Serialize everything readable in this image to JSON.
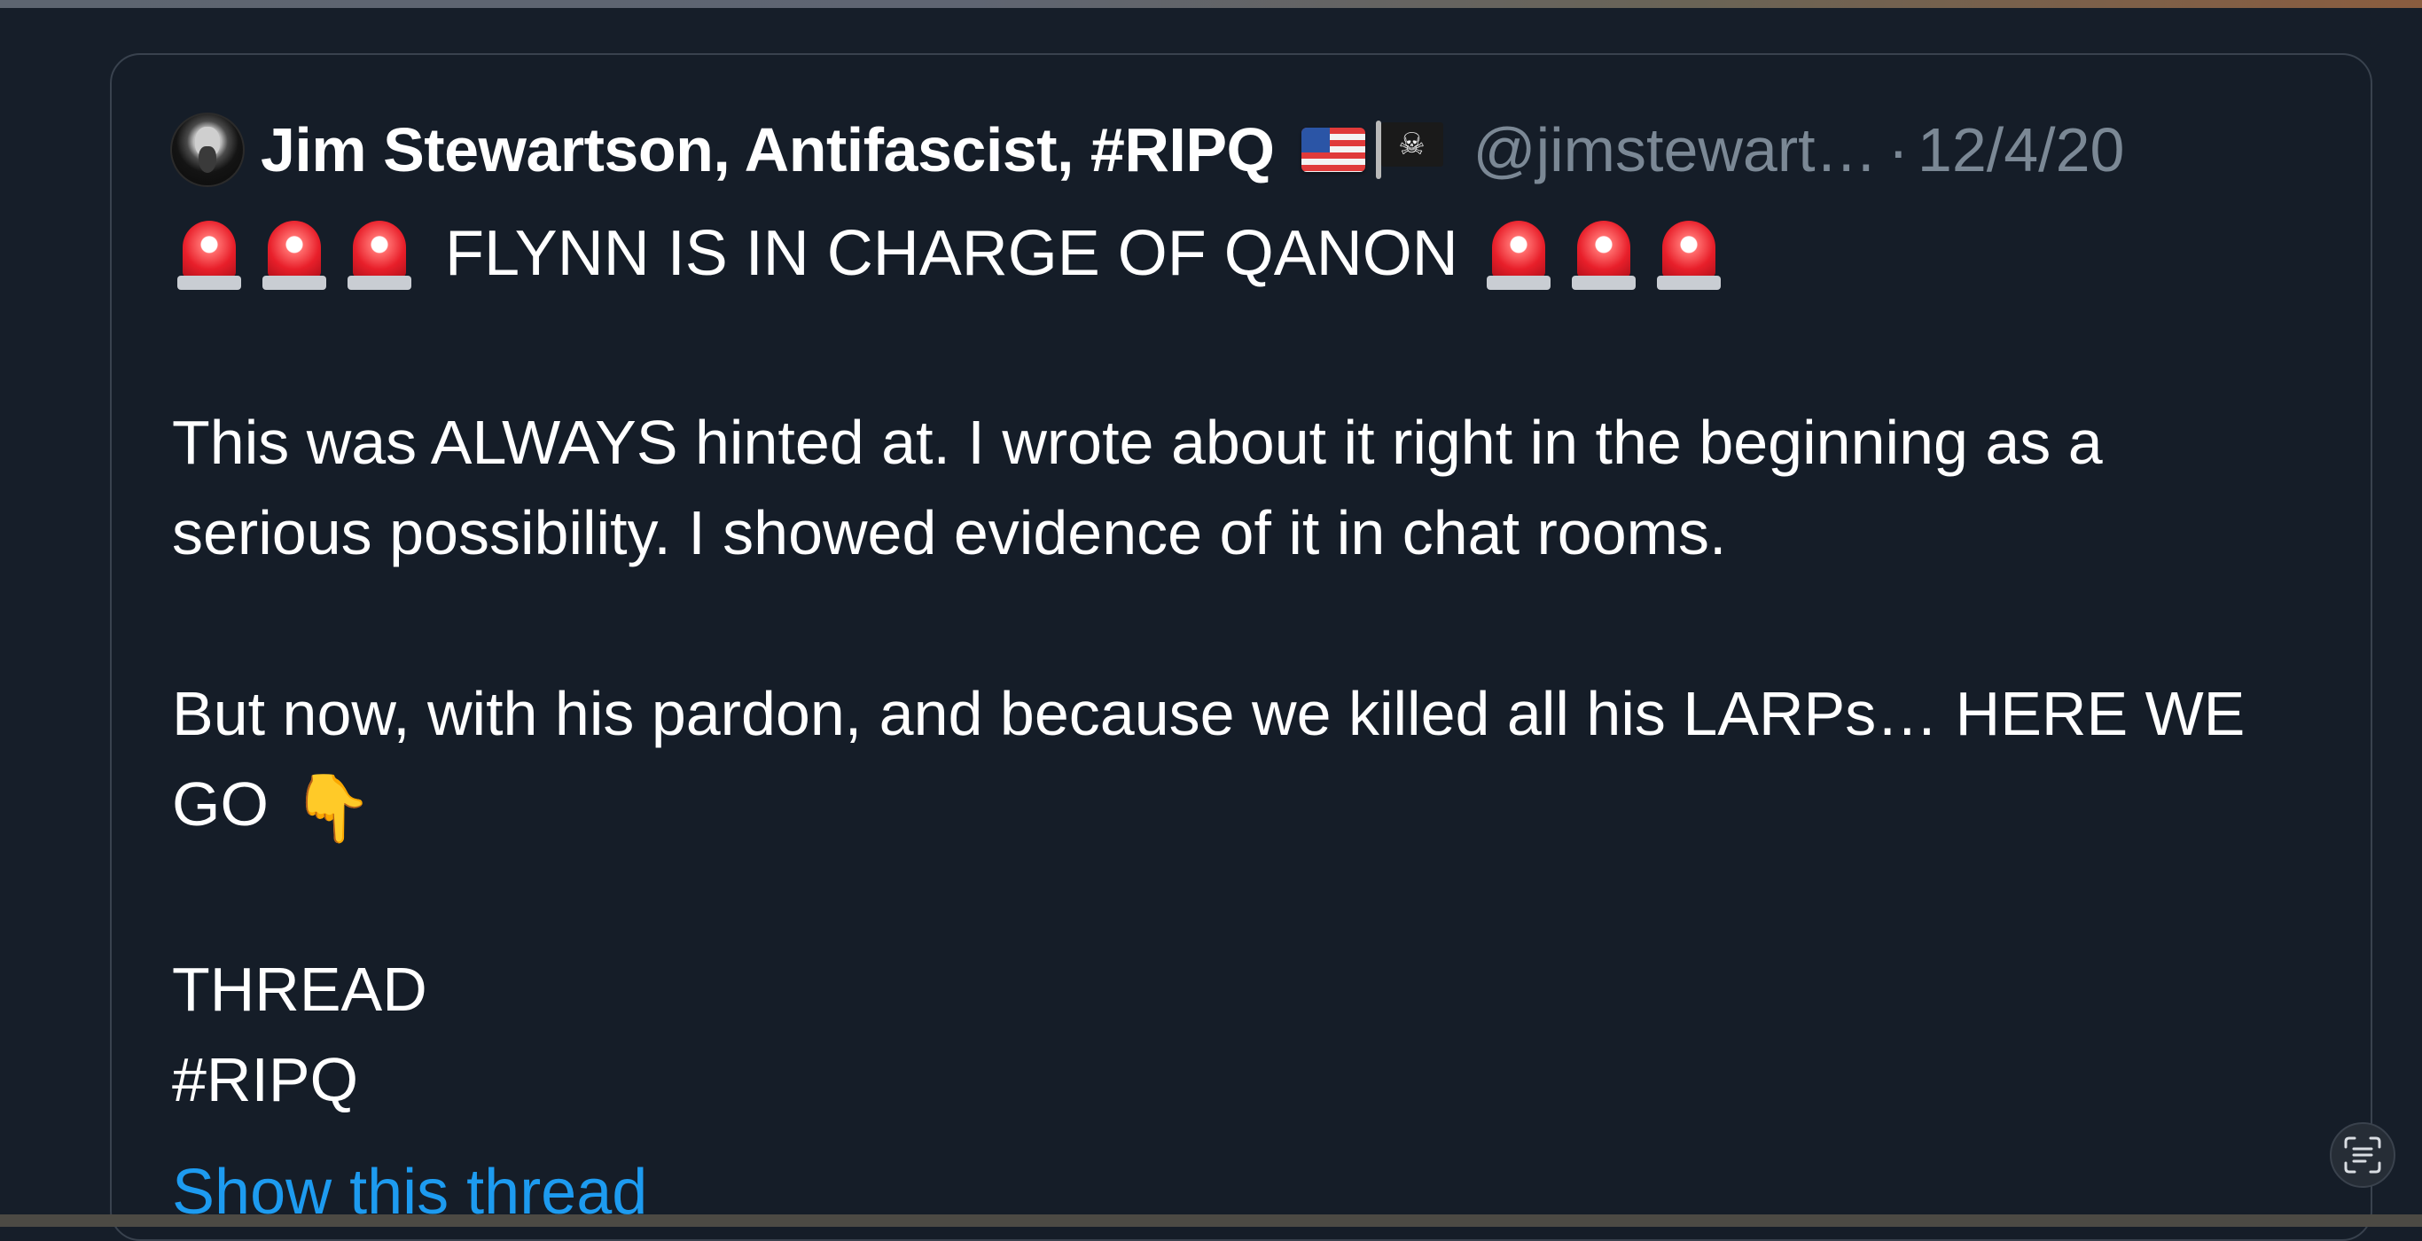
{
  "tweet": {
    "author_name": "Jim Stewartson, Antifascist, #RIPQ",
    "name_flags": [
      "us-flag-icon",
      "pirate-flag-icon"
    ],
    "handle": "@jimstewart…",
    "separator": "·",
    "date": "12/4/20",
    "headline": "FLYNN IS IN CHARGE OF QANON",
    "headline_icon": "police-siren-icon",
    "paragraph_1": "This was ALWAYS hinted at. I wrote about it right in the beginning as a serious possibility. I showed evidence of it in chat rooms.",
    "paragraph_2": "But now, with his pardon, and because we killed all his LARPs… HERE WE GO",
    "paragraph_2_icon": "backhand-pointing-down-icon",
    "thread_line": "THREAD",
    "hashtag_line": "#RIPQ",
    "show_thread_link": "Show this thread"
  },
  "overlay": {
    "scan_button_icon": "text-scan-icon"
  },
  "colors": {
    "background": "#161e29",
    "card_border": "#39424e",
    "secondary_text": "#7b8895",
    "link": "#1d9bf0"
  }
}
